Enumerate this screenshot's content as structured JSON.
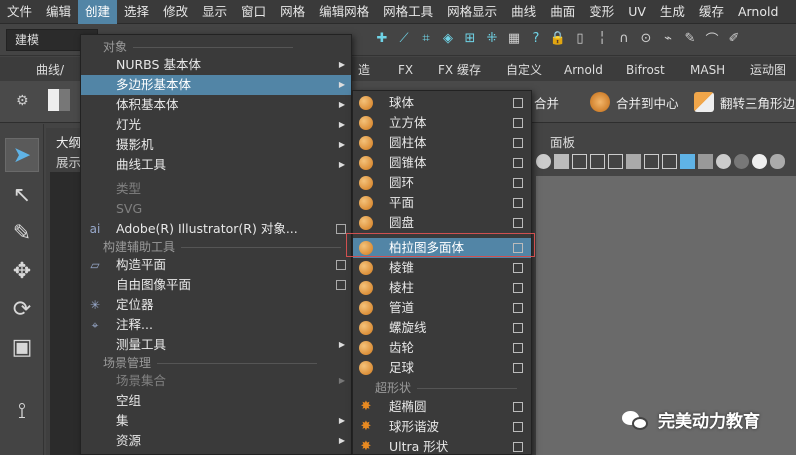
{
  "menubar": [
    "文件",
    "编辑",
    "创建",
    "选择",
    "修改",
    "显示",
    "窗口",
    "网格",
    "编辑网格",
    "网格工具",
    "网格显示",
    "曲线",
    "曲面",
    "变形",
    "UV",
    "生成",
    "缓存",
    "Arnold"
  ],
  "menubar_active_index": 2,
  "mode_select": "建模",
  "shelf_tabs": [
    "曲线/",
    "造",
    "FX",
    "FX 缓存",
    "自定义",
    "Arnold",
    "Bifrost",
    "MASH",
    "运动图"
  ],
  "shelf_items": [
    "合并",
    "合并到中心",
    "翻转三角形边"
  ],
  "outliner": {
    "title": "大纲",
    "subtitle": "展示"
  },
  "viewport": {
    "panel_label": "面板"
  },
  "menu": {
    "section_objects": "对象",
    "nurbs": "NURBS 基本体",
    "poly": "多边形基本体",
    "volume": "体积基本体",
    "lights": "灯光",
    "cameras": "摄影机",
    "curve_tools": "曲线工具",
    "type": "类型",
    "svg": "SVG",
    "illustrator": "Adobe(R) Illustrator(R) 对象...",
    "section_construction": "构建辅助工具",
    "construction_plane": "构造平面",
    "free_image_plane": "自由图像平面",
    "locator": "定位器",
    "annotation": "注释...",
    "measure": "测量工具",
    "section_scene": "场景管理",
    "scene_set": "场景集合",
    "empty_group": "空组",
    "sets": "集",
    "assets": "资源"
  },
  "submenu": {
    "items": [
      "球体",
      "立方体",
      "圆柱体",
      "圆锥体",
      "圆环",
      "平面",
      "圆盘",
      "柏拉图多面体",
      "棱锥",
      "棱柱",
      "管道",
      "螺旋线",
      "齿轮",
      "足球"
    ],
    "highlighted": "柏拉图多面体",
    "section_super": "超形状",
    "super_items": [
      "超椭圆",
      "球形谐波",
      "Ultra 形状"
    ]
  },
  "watermark": "完美动力教育",
  "colors": {
    "highlight": "#5285a6",
    "accent_icon": "#6fd3e6",
    "primitive_icon": "#e08a2a",
    "frame": "#d05050"
  }
}
